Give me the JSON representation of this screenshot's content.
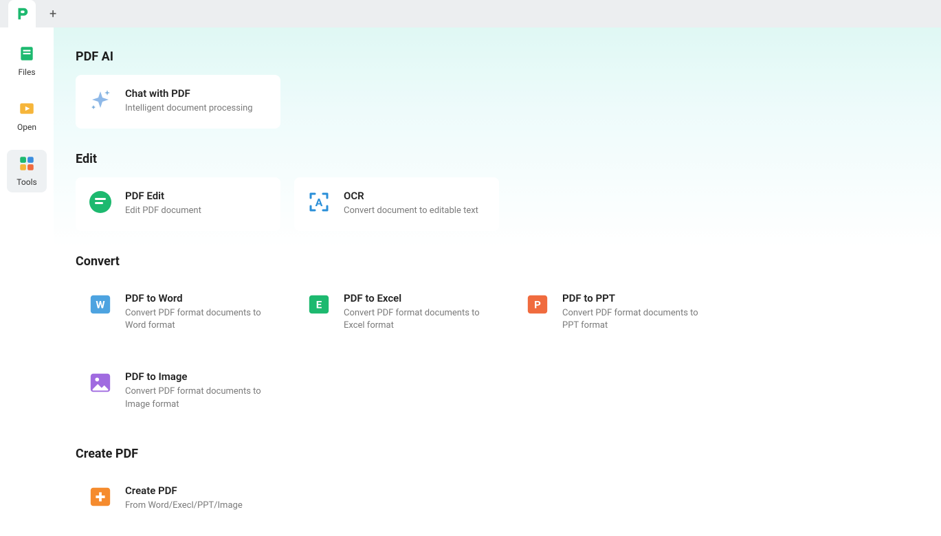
{
  "sidebar": {
    "files": "Files",
    "open": "Open",
    "tools": "Tools"
  },
  "sections": {
    "ai": {
      "title": "PDF AI",
      "cards": [
        {
          "title": "Chat with PDF",
          "desc": "Intelligent document processing"
        }
      ]
    },
    "edit": {
      "title": "Edit",
      "cards": [
        {
          "title": "PDF Edit",
          "desc": "Edit PDF document"
        },
        {
          "title": "OCR",
          "desc": "Convert document to editable text"
        }
      ]
    },
    "convert": {
      "title": "Convert",
      "cards": [
        {
          "title": "PDF to Word",
          "desc": "Convert PDF format documents to Word format"
        },
        {
          "title": "PDF to Excel",
          "desc": "Convert PDF format documents to Excel format"
        },
        {
          "title": "PDF to PPT",
          "desc": "Convert PDF format documents to PPT format"
        },
        {
          "title": "PDF to Image",
          "desc": "Convert PDF format documents to Image format"
        }
      ]
    },
    "create": {
      "title": "Create PDF",
      "cards": [
        {
          "title": "Create PDF",
          "desc": "From Word/Execl/PPT/Image"
        }
      ]
    }
  }
}
